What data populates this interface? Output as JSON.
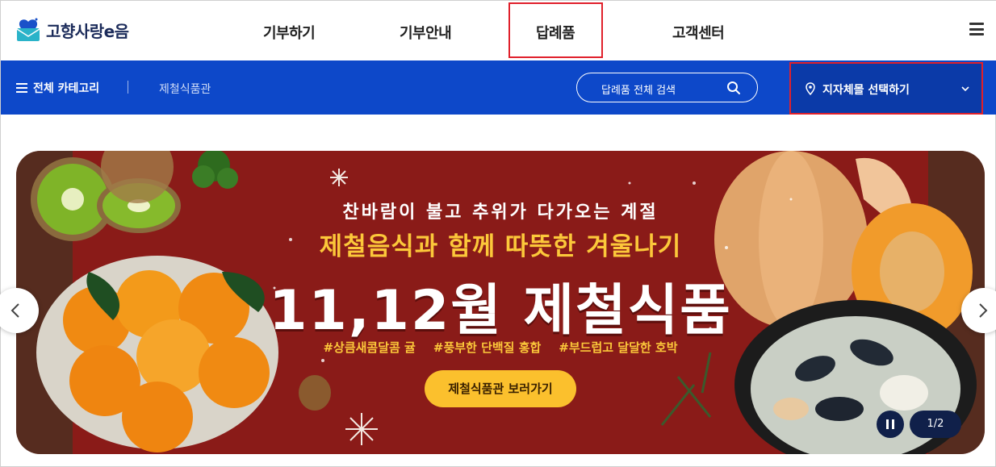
{
  "header": {
    "logo_text": "고향사랑e음",
    "nav": [
      "기부하기",
      "기부안내",
      "답례품",
      "고객센터"
    ]
  },
  "subnav": {
    "all_categories": "전체 카테고리",
    "breadcrumb": "제철식품관",
    "search_placeholder": "답례품 전체 검색",
    "region_select": "지자체몰 선택하기"
  },
  "banner": {
    "subtitle": "찬바람이 불고 추위가 다가오는 계절",
    "headline": "제철음식과 함께 따뜻한 겨울나기",
    "big_title": "11,12월 제철식품",
    "tags": [
      "#상큼새콤달콤 귤",
      "#풍부한 단백질 홍합",
      "#부드럽고 달달한 호박"
    ],
    "cta": "제철식품관 보러가기",
    "counter": "1/2"
  },
  "colors": {
    "primary_blue": "#0d48c9",
    "banner_red": "#8a1b18",
    "accent_yellow": "#fcc83a",
    "highlight_red": "#e0202b"
  }
}
